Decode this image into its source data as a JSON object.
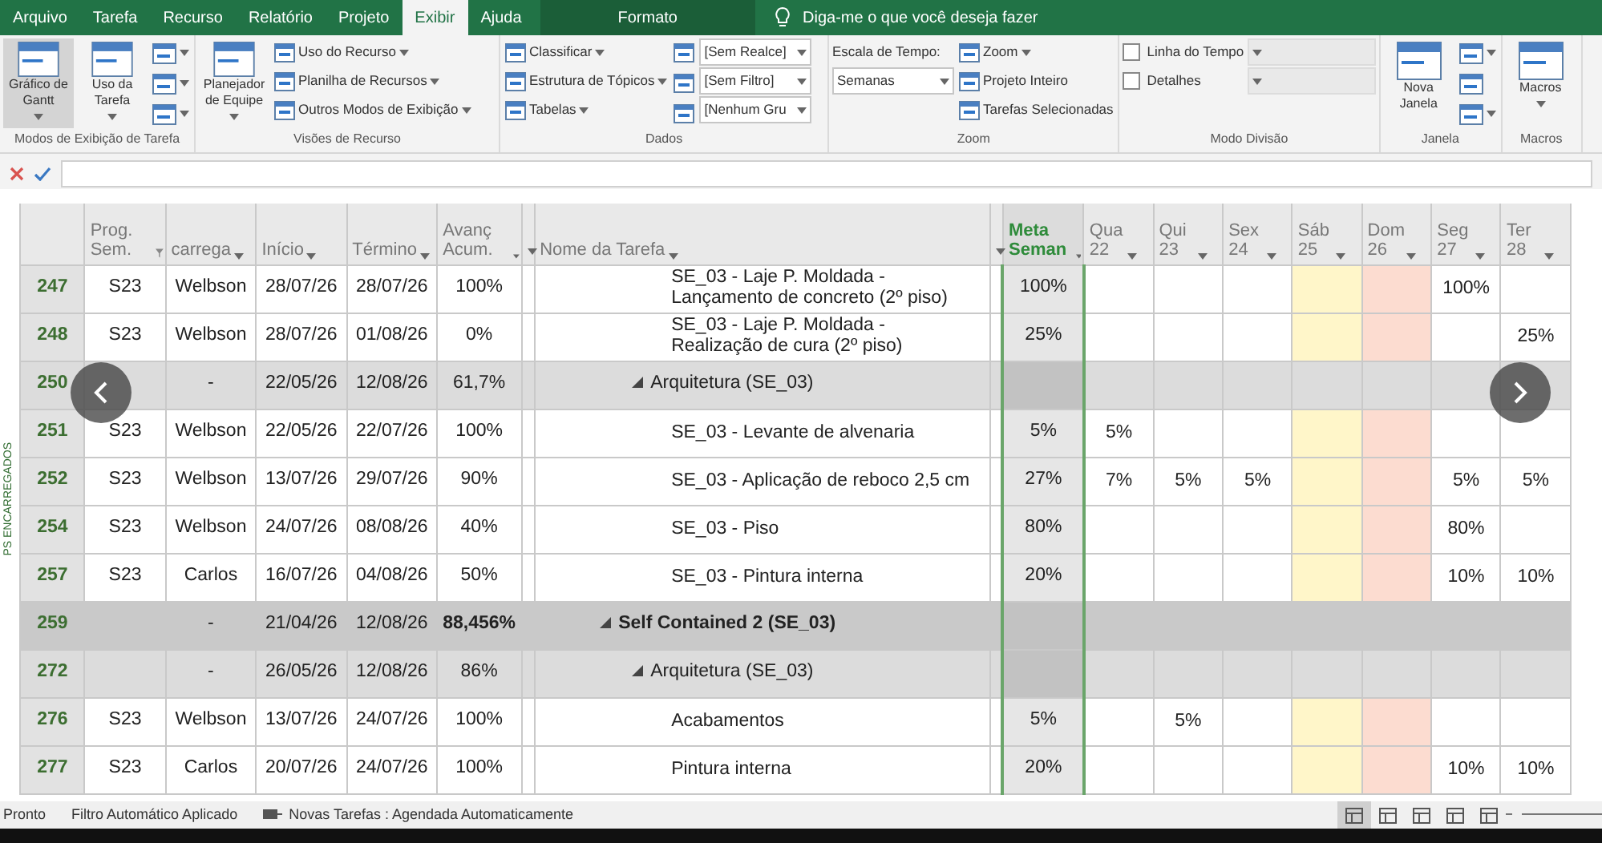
{
  "tabs": [
    {
      "label": "Arquivo",
      "selected": false
    },
    {
      "label": "Tarefa",
      "selected": false
    },
    {
      "label": "Recurso",
      "selected": false
    },
    {
      "label": "Relatório",
      "selected": false
    },
    {
      "label": "Projeto",
      "selected": false
    },
    {
      "label": "Exibir",
      "selected": true
    },
    {
      "label": "Ajuda",
      "selected": false
    }
  ],
  "contextual_tab": {
    "label": "Formato"
  },
  "tell_me": {
    "placeholder": "Diga-me o que você deseja fazer"
  },
  "ribbon": [
    {
      "label": "Modos de Exibição de Tarefa",
      "columns": [
        [
          {
            "kind": "large",
            "label": "Gráfico de Gantt",
            "dropdown": true,
            "selected": true
          }
        ],
        [
          {
            "kind": "large",
            "label": "Uso da Tarefa",
            "dropdown": true,
            "selected": false
          }
        ],
        [
          {
            "kind": "icon",
            "dropdown": true
          },
          {
            "kind": "icon",
            "dropdown": true
          },
          {
            "kind": "icon",
            "dropdown": true
          }
        ]
      ]
    },
    {
      "label": "Visões de Recurso",
      "columns": [
        [
          {
            "kind": "large",
            "label": "Planejador de Equipe",
            "dropdown": true,
            "selected": false
          }
        ],
        [
          {
            "kind": "small",
            "label": "Uso do Recurso",
            "dropdown": true
          },
          {
            "kind": "small",
            "label": "Planilha de Recursos",
            "dropdown": true
          },
          {
            "kind": "small",
            "label": "Outros Modos de Exibição",
            "dropdown": true
          }
        ]
      ]
    },
    {
      "label": "Dados",
      "columns": [
        [
          {
            "kind": "small",
            "label": "Classificar",
            "dropdown": true
          },
          {
            "kind": "small",
            "label": "Estrutura de Tópicos",
            "dropdown": true
          },
          {
            "kind": "small",
            "label": "Tabelas",
            "dropdown": true
          }
        ],
        [
          {
            "kind": "glyph"
          },
          {
            "kind": "glyph"
          },
          {
            "kind": "glyph"
          }
        ],
        [
          {
            "kind": "combo",
            "value": "[Sem Realce]",
            "disabled": false
          },
          {
            "kind": "combo",
            "value": "[Sem Filtro]",
            "disabled": false
          },
          {
            "kind": "combo",
            "value": "[Nenhum Gru",
            "disabled": false
          }
        ]
      ]
    },
    {
      "label": "Zoom",
      "columns": [
        [
          {
            "kind": "text",
            "label": "Escala de Tempo:"
          },
          {
            "kind": "combo",
            "value": "Semanas",
            "disabled": false
          }
        ],
        [
          {
            "kind": "small",
            "label": "Zoom",
            "dropdown": true
          },
          {
            "kind": "small",
            "label": "Projeto Inteiro",
            "dropdown": false
          },
          {
            "kind": "small",
            "label": "Tarefas Selecionadas",
            "dropdown": false
          }
        ]
      ]
    },
    {
      "label": "Modo Divisão",
      "columns": [
        [
          {
            "kind": "check",
            "label": "Linha do Tempo",
            "checked": false
          },
          {
            "kind": "check",
            "label": "Detalhes",
            "checked": false
          }
        ],
        [
          {
            "kind": "combo",
            "disabled": true
          },
          {
            "kind": "combo",
            "disabled": true
          }
        ]
      ]
    },
    {
      "label": "Janela",
      "columns": [
        [
          {
            "kind": "large",
            "label": "Nova Janela",
            "dropdown": false,
            "selected": false
          }
        ],
        [
          {
            "kind": "icon",
            "dropdown": true
          },
          {
            "kind": "icon",
            "dropdown": false
          },
          {
            "kind": "icon",
            "dropdown": true
          }
        ]
      ]
    },
    {
      "label": "Macros",
      "columns": [
        [
          {
            "kind": "large",
            "label": "Macros",
            "dropdown": true,
            "selected": false
          }
        ]
      ]
    }
  ],
  "side_label": "PS ENCARREGADOS",
  "columns": [
    {
      "label": "Prog. Sem.",
      "filtered": true,
      "menu": false
    },
    {
      "label": "carrega",
      "filtered": false,
      "menu": true
    },
    {
      "label": "Início",
      "filtered": false,
      "menu": true
    },
    {
      "label": "Término",
      "filtered": false,
      "menu": true
    },
    {
      "label": "Avanç Acum.",
      "filtered": false,
      "menu": true
    },
    {
      "filtered": false,
      "menu": true
    },
    {
      "label": "Nome da Tarefa",
      "filtered": false,
      "menu": true
    },
    {
      "filtered": false,
      "menu": true
    },
    {
      "label": "Meta Seman",
      "filtered": false,
      "menu": true,
      "highlighted": true
    }
  ],
  "days": [
    {
      "label": "Qua",
      "date": "22",
      "kind": "weekday"
    },
    {
      "label": "Qui",
      "date": "23",
      "kind": "weekday"
    },
    {
      "label": "Sex",
      "date": "24",
      "kind": "weekday"
    },
    {
      "label": "Sáb",
      "date": "25",
      "kind": "saturday"
    },
    {
      "label": "Dom",
      "date": "26",
      "kind": "sunday"
    },
    {
      "label": "Seg",
      "date": "27",
      "kind": "weekday"
    },
    {
      "label": "Ter",
      "date": "28",
      "kind": "weekday"
    }
  ],
  "rows": [
    {
      "id": "247",
      "kind": "task",
      "week": "S23",
      "owner": "Welbson",
      "start": "28/07/26",
      "finish": "28/07/26",
      "progress": "100%",
      "name": "SE_03 - Laje P. Moldada - Lançamento de concreto (2º piso)",
      "meta": "100%",
      "daily": {
        "day_6": "100%"
      }
    },
    {
      "id": "248",
      "kind": "task",
      "week": "S23",
      "owner": "Welbson",
      "start": "28/07/26",
      "finish": "01/08/26",
      "progress": "0%",
      "name": "SE_03 - Laje P. Moldada - Realização de cura (2º piso)",
      "meta": "25%",
      "daily": {
        "day_7": "25%"
      }
    },
    {
      "id": "250",
      "kind": "summary",
      "owner": "-",
      "start": "22/05/26",
      "finish": "12/08/26",
      "progress": "61,7%",
      "name": "Arquitetura (SE_03)",
      "expanded": true
    },
    {
      "id": "251",
      "kind": "task",
      "week": "S23",
      "owner": "Welbson",
      "start": "22/05/26",
      "finish": "22/07/26",
      "progress": "100%",
      "name": "SE_03 - Levante de alvenaria",
      "meta": "5%",
      "daily": {
        "day_1": "5%"
      }
    },
    {
      "id": "252",
      "kind": "task",
      "week": "S23",
      "owner": "Welbson",
      "start": "13/07/26",
      "finish": "29/07/26",
      "progress": "90%",
      "name": "SE_03 - Aplicação de reboco 2,5 cm",
      "meta": "27%",
      "daily": {
        "day_1": "7%",
        "day_2": "5%",
        "day_3": "5%",
        "day_6": "5%",
        "day_7": "5%"
      }
    },
    {
      "id": "254",
      "kind": "task",
      "week": "S23",
      "owner": "Welbson",
      "start": "24/07/26",
      "finish": "08/08/26",
      "progress": "40%",
      "name": "SE_03 - Piso",
      "meta": "80%",
      "daily": {
        "day_6": "80%"
      }
    },
    {
      "id": "257",
      "kind": "task",
      "week": "S23",
      "owner": "Carlos",
      "start": "16/07/26",
      "finish": "04/08/26",
      "progress": "50%",
      "name": "SE_03 - Pintura interna",
      "meta": "20%",
      "daily": {
        "day_6": "10%",
        "day_7": "10%"
      }
    },
    {
      "id": "259",
      "kind": "project",
      "owner": "-",
      "start": "21/04/26",
      "finish": "12/08/26",
      "progress": "88,456%",
      "name": "Self Contained 2 (SE_03)",
      "expanded": true
    },
    {
      "id": "272",
      "kind": "summary",
      "owner": "-",
      "start": "26/05/26",
      "finish": "12/08/26",
      "progress": "86%",
      "name": "Arquitetura (SE_03)",
      "expanded": true
    },
    {
      "id": "276",
      "kind": "task",
      "week": "S23",
      "owner": "Welbson",
      "start": "13/07/26",
      "finish": "24/07/26",
      "progress": "100%",
      "name": "Acabamentos",
      "meta": "5%",
      "daily": {
        "day_2": "5%"
      }
    },
    {
      "id": "277",
      "kind": "task",
      "week": "S23",
      "owner": "Carlos",
      "start": "20/07/26",
      "finish": "24/07/26",
      "progress": "100%",
      "name": "Pintura interna",
      "meta": "20%",
      "daily": {
        "day_6": "10%",
        "day_7": "10%"
      }
    }
  ],
  "status_bar": {
    "ready": "Pronto",
    "filter": "Filtro Automático Aplicado",
    "new_tasks": "Novas Tarefas : Agendada Automaticamente"
  }
}
